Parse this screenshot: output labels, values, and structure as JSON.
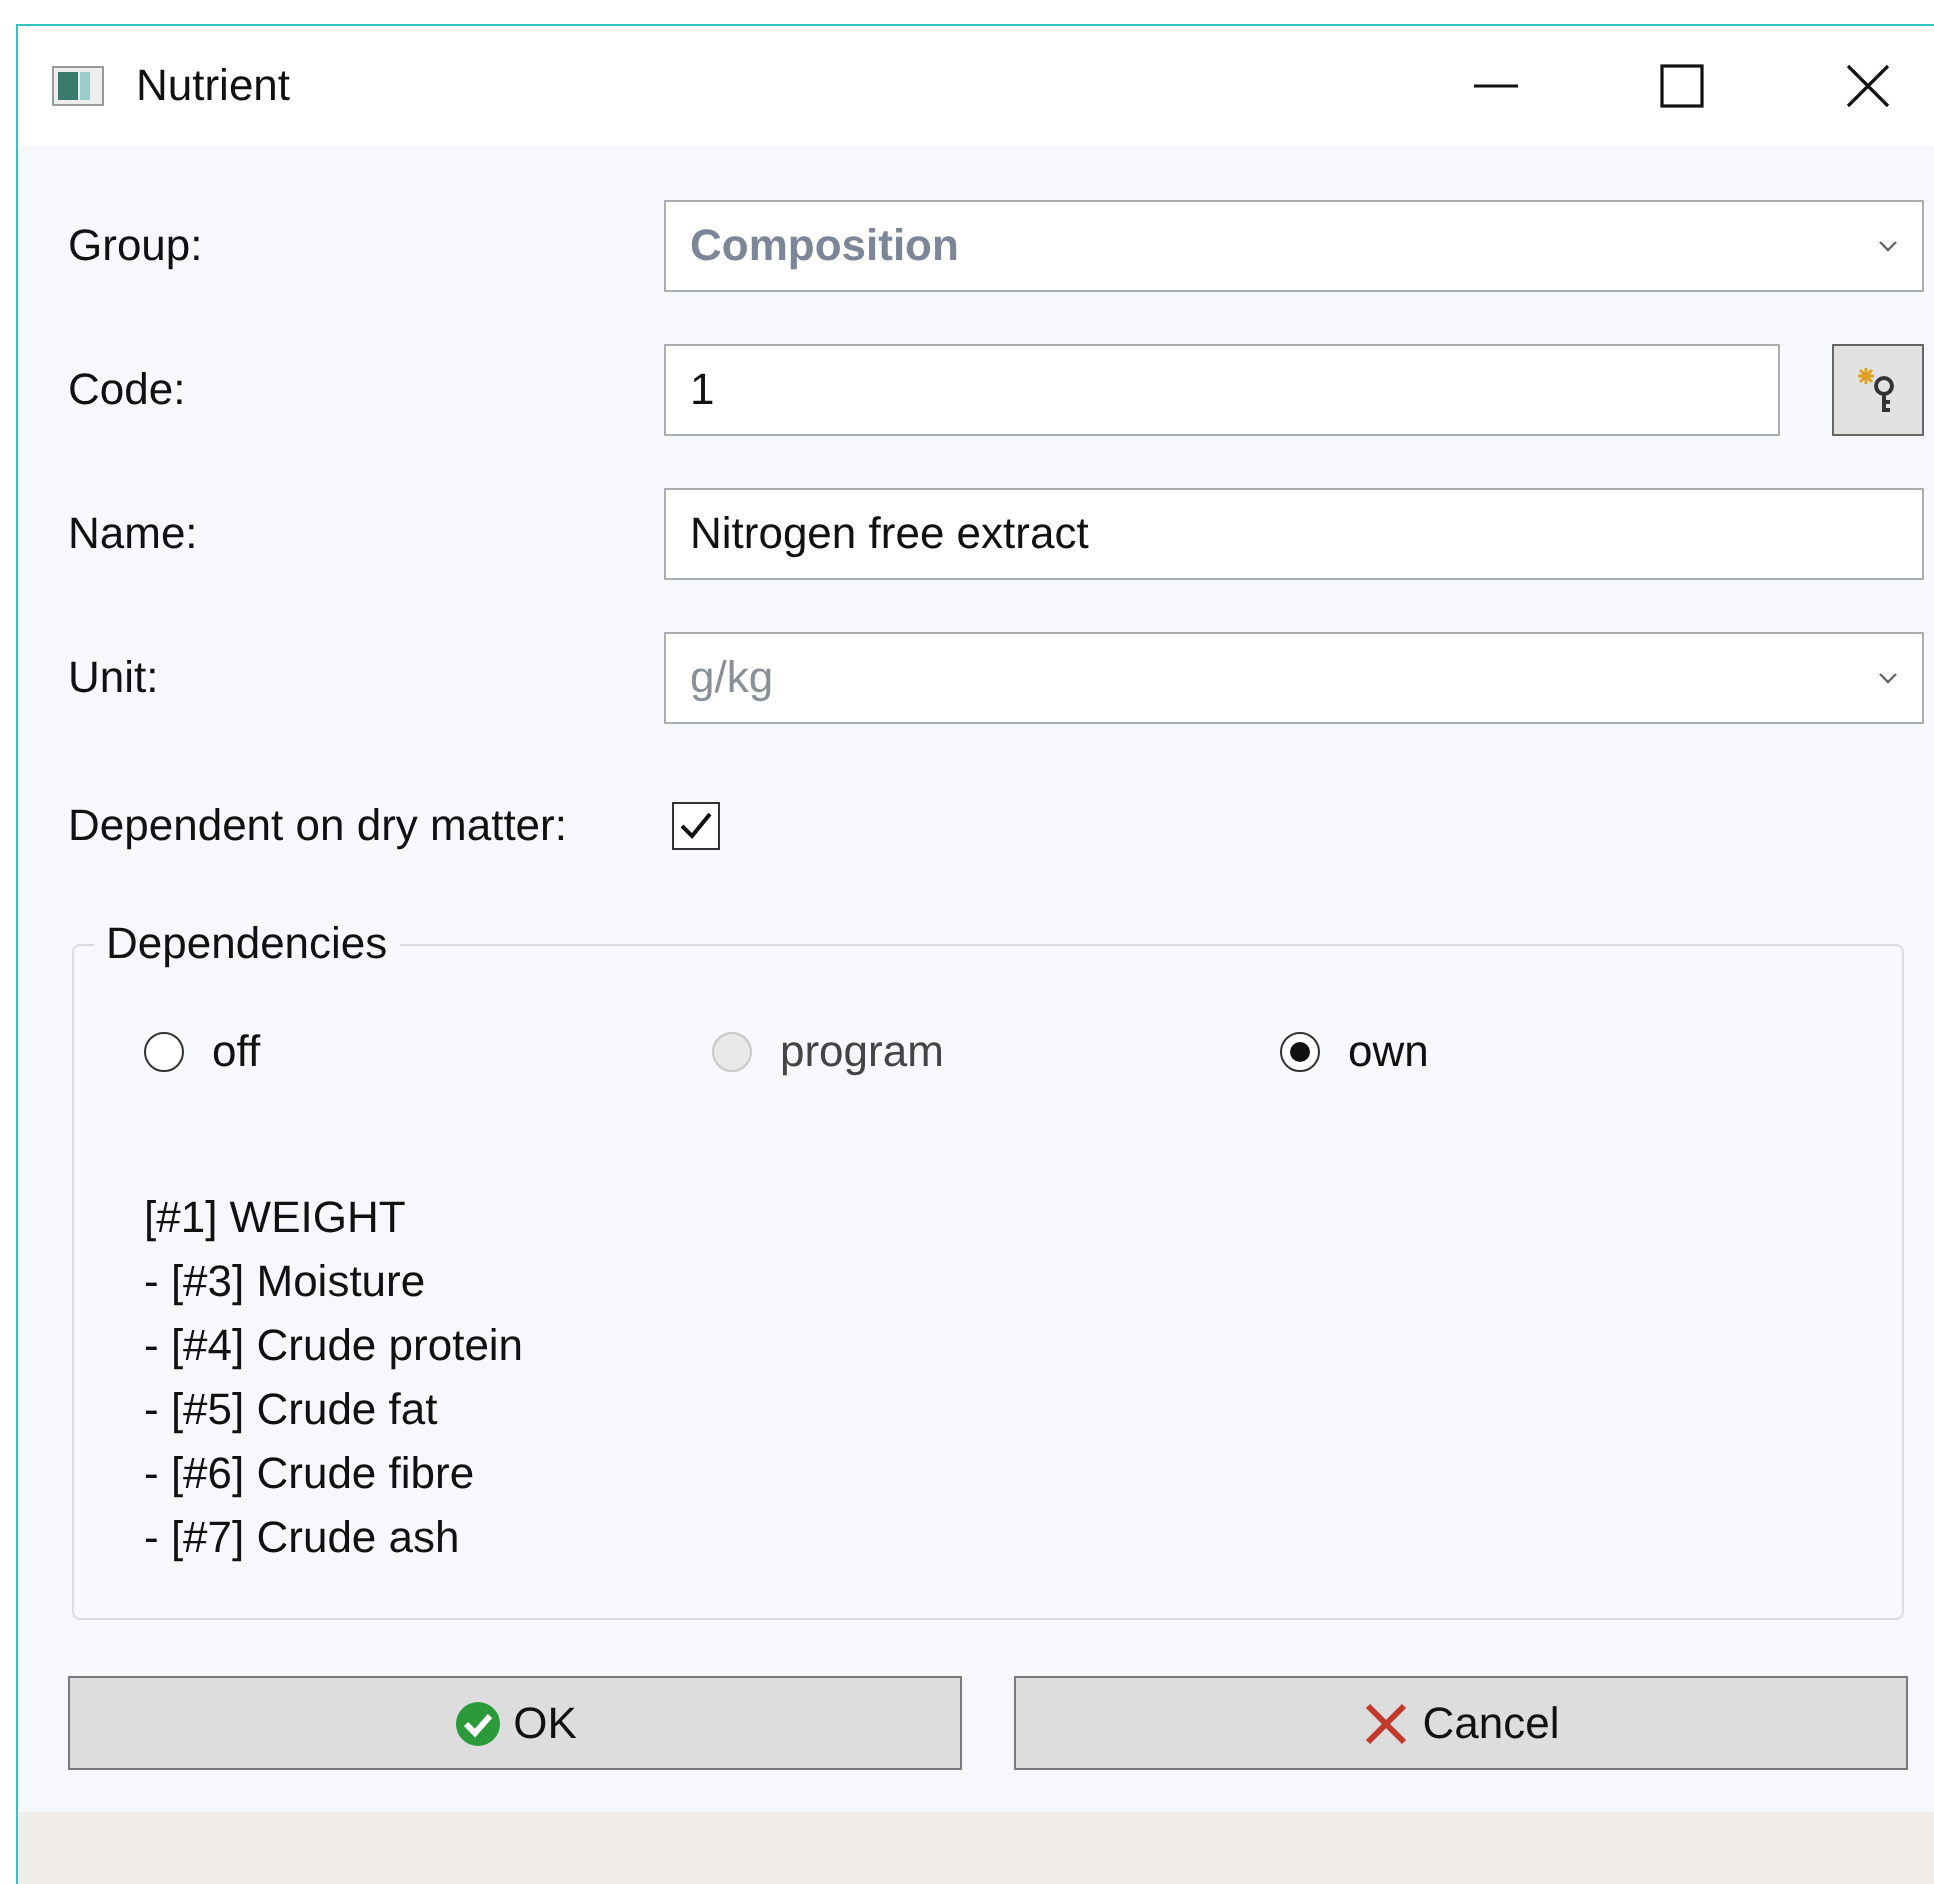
{
  "window": {
    "title": "Nutrient"
  },
  "fields": [
    {
      "label": "Group:",
      "kind": "dropdown",
      "value": "Composition",
      "disabled": true
    },
    {
      "label": "Code:",
      "kind": "text_with_button",
      "value": "1",
      "disabled": false
    },
    {
      "label": "Name:",
      "kind": "text",
      "value": "Nitrogen free extract",
      "disabled": false
    },
    {
      "label": "Unit:",
      "kind": "dropdown",
      "value": "g/kg",
      "disabled": true
    }
  ],
  "dry_matter": {
    "label": "Dependent on dry matter:",
    "checked": true
  },
  "dependencies": {
    "title": "Dependencies",
    "options": [
      {
        "label": "off",
        "selected": false,
        "disabled": false
      },
      {
        "label": "program",
        "selected": false,
        "disabled": true
      },
      {
        "label": "own",
        "selected": true,
        "disabled": false
      }
    ],
    "lines": [
      "[#1] WEIGHT",
      "- [#3] Moisture",
      "- [#4] Crude protein",
      "- [#5] Crude fat",
      "- [#6] Crude fibre",
      "- [#7] Crude ash"
    ]
  },
  "buttons": [
    {
      "label": "OK",
      "kind": "ok"
    },
    {
      "label": "Cancel",
      "kind": "cancel"
    }
  ]
}
